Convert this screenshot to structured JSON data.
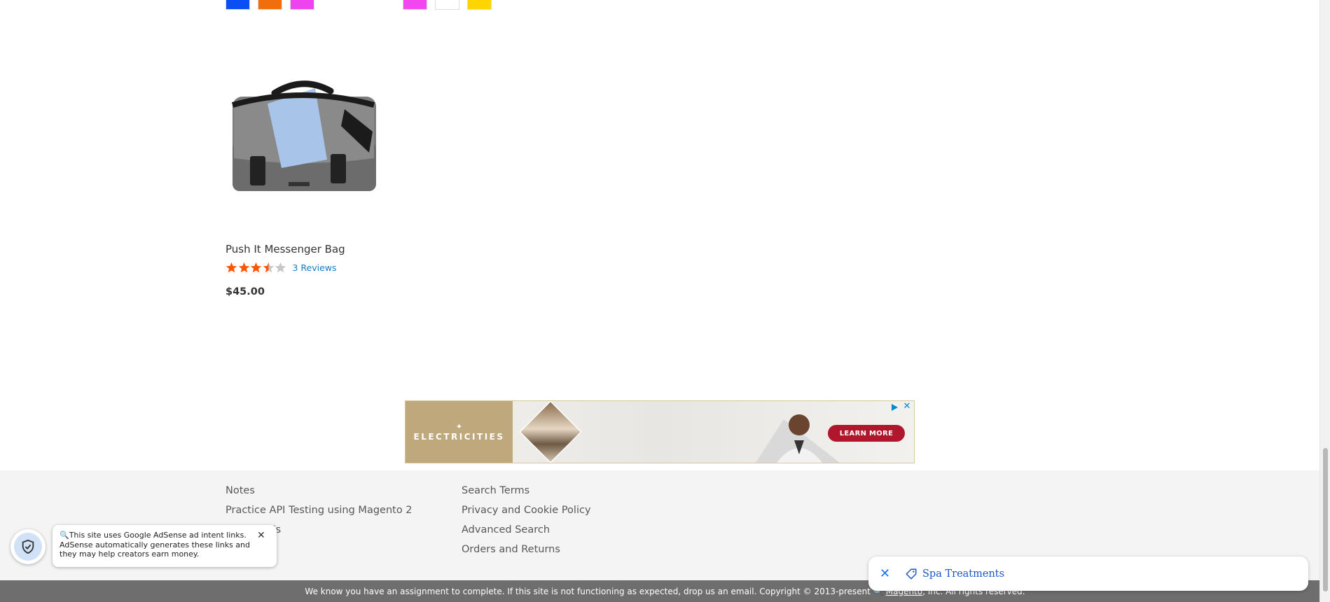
{
  "swatches": {
    "row": [
      {
        "color": "#0c4ef5",
        "label": "Blue"
      },
      {
        "color": "#f06f0c",
        "label": "Orange"
      },
      {
        "color": "#ee44ef",
        "label": "Purple"
      },
      {
        "color": "#f246f0",
        "label": "Purple"
      },
      {
        "color": "#ffffff",
        "label": "White"
      },
      {
        "color": "#ffd500",
        "label": "Yellow"
      }
    ]
  },
  "product": {
    "name": "Push It Messenger Bag",
    "rating_stars": 3.5,
    "rating_max": 5,
    "reviews_label": "3 Reviews",
    "price": "$45.00",
    "image_icon": "messenger-bag-image"
  },
  "ad": {
    "brand_mark": "✦",
    "brand_name": "ELECTRICITIES",
    "cta": "LEARN MORE",
    "close_symbol": "✕",
    "brand_color": "#bfa87c",
    "cta_color": "#b0172d"
  },
  "footer": {
    "col1": [
      "Notes",
      "Practice API Testing using Magento 2",
      "Contact Us"
    ],
    "col2": [
      "Search Terms",
      "Privacy and Cookie Policy",
      "Advanced Search",
      "Orders and Returns"
    ]
  },
  "copyright": {
    "text": "We know you have an assignment to complete. If this site is not functioning as expected, drop us an email. Copyright © 2013-present 🔍",
    "magento": "Magento",
    "suffix": ", Inc. All rights reserved."
  },
  "adsense_notice": {
    "text": "🔍This site uses Google AdSense ad intent links. AdSense automatically generates these links and they may help creators earn money.",
    "close_symbol": "✕"
  },
  "intent_chip": {
    "close_symbol": "✕",
    "label": "Spa Treatments",
    "accent": "#1a56c8"
  }
}
